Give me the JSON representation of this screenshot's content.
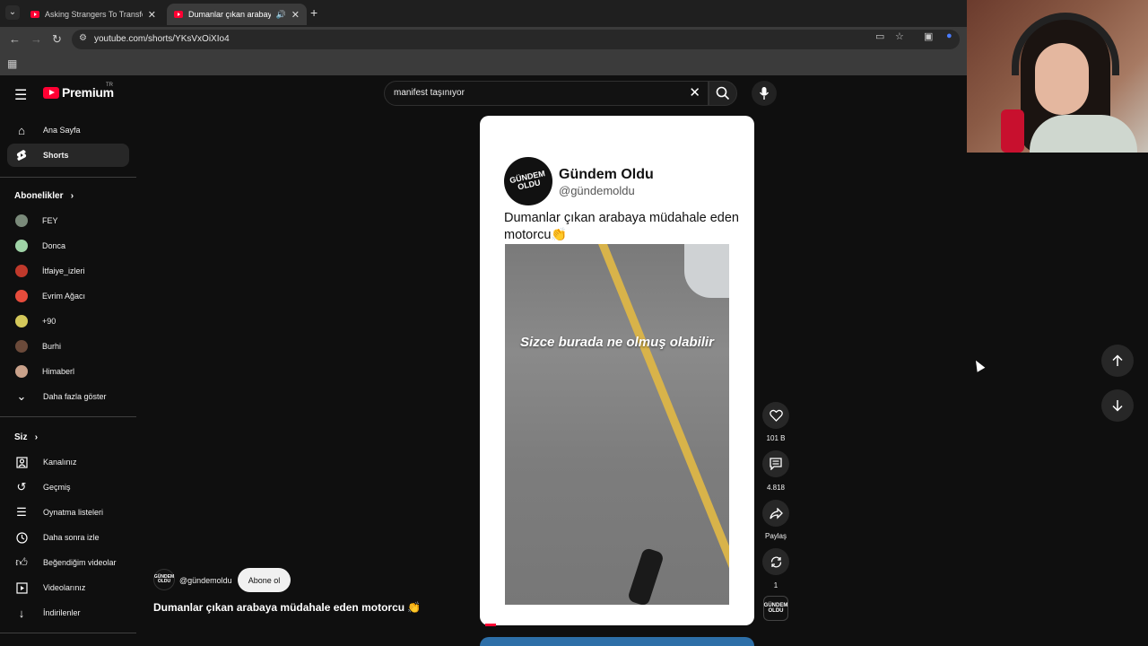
{
  "browser": {
    "tabs": [
      {
        "title": "Asking Strangers To Transform"
      },
      {
        "title": "Dumanlar çıkan arabaya mü"
      }
    ],
    "url": "youtube.com/shorts/YKsVxOiXIo4"
  },
  "header": {
    "logo_word": "Premium",
    "country": "TR",
    "search_value": "manifest taşınıyor"
  },
  "sidebar": {
    "main": [
      {
        "label": "Ana Sayfa",
        "icon": "home-icon"
      },
      {
        "label": "Shorts",
        "icon": "shorts-icon"
      }
    ],
    "subscriptions_heading": "Abonelikler",
    "subscriptions": [
      {
        "label": "FEY",
        "color": "#7a8a7a"
      },
      {
        "label": "Donca",
        "color": "#9fd3a6"
      },
      {
        "label": "İtfaiye_izleri",
        "color": "#c0392b"
      },
      {
        "label": "Evrim Ağacı",
        "color": "#e74c3c"
      },
      {
        "label": "+90",
        "color": "#d4c85a"
      },
      {
        "label": "Burhi",
        "color": "#6b4a3a"
      },
      {
        "label": "Himaberl",
        "color": "#c9a18a"
      }
    ],
    "show_more": "Daha fazla göster",
    "you_heading": "Siz",
    "you_items": [
      {
        "label": "Kanalınız",
        "icon": "user-icon"
      },
      {
        "label": "Geçmiş",
        "icon": "history-icon"
      },
      {
        "label": "Oynatma listeleri",
        "icon": "playlist-icon"
      },
      {
        "label": "Daha sonra izle",
        "icon": "clock-icon"
      },
      {
        "label": "Beğendiğim videolar",
        "icon": "like-icon"
      },
      {
        "label": "Videolarınız",
        "icon": "video-icon"
      },
      {
        "label": "İndirilenler",
        "icon": "download-icon"
      }
    ]
  },
  "short": {
    "tweet_name": "Gündem Oldu",
    "tweet_handle": "@gündemoldu",
    "tweet_text": "Dumanlar çıkan arabaya müdahale eden motorcu👏",
    "avatar_text": "GÜNDEM OLDU",
    "video_caption": "Sizce burada ne olmuş olabilir",
    "channel_handle": "@gündemoldu",
    "subscribe_label": "Abone ol",
    "title": "Dumanlar çıkan arabaya müdahale eden motorcu 👏"
  },
  "actions": {
    "likes": "101 B",
    "comments": "4.818",
    "share": "Paylaş",
    "remix": "1"
  }
}
